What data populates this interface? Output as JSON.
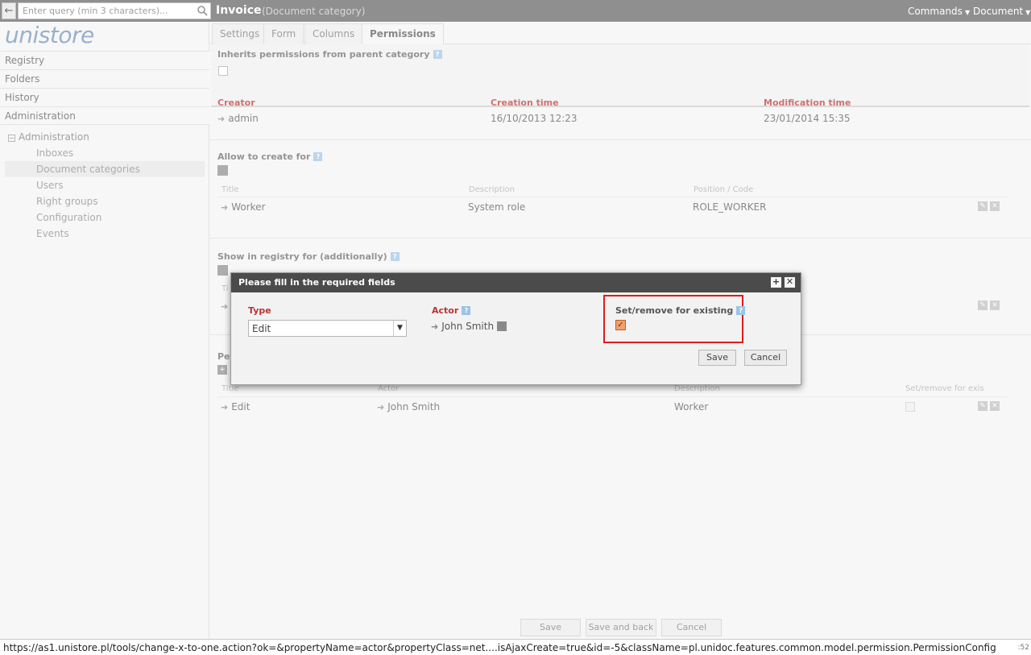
{
  "search": {
    "placeholder": "Enter query (min 3 characters)..."
  },
  "header": {
    "title": "Invoice",
    "subtitle": "(Document category)",
    "commands_label": "Commands",
    "document_label": "Document"
  },
  "sidebar": {
    "logo": "unistore",
    "nav": [
      "Registry",
      "Folders",
      "History",
      "Administration"
    ],
    "tree_root": "Administration",
    "tree_items": [
      "Inboxes",
      "Document categories",
      "Users",
      "Right groups",
      "Configuration",
      "Events"
    ]
  },
  "tabs": [
    "Settings",
    "Form",
    "Columns",
    "Permissions"
  ],
  "inherit": {
    "label": "Inherits permissions from parent category",
    "checked": false
  },
  "meta": {
    "creator_label": "Creator",
    "creator_value": "admin",
    "creation_label": "Creation time",
    "creation_value": "16/10/2013 12:23",
    "modification_label": "Modification time",
    "modification_value": "23/01/2014 15:35"
  },
  "allow_create": {
    "title": "Allow to create for",
    "columns": [
      "Title",
      "Description",
      "Position / Code"
    ],
    "row": {
      "title": "Worker",
      "description": "System role",
      "code": "ROLE_WORKER"
    }
  },
  "show_registry": {
    "title": "Show in registry for (additionally)",
    "col_fragment": "Ti"
  },
  "permissions": {
    "title_fragment": "Per",
    "columns": [
      "Title",
      "Actor",
      "Description",
      "Set/remove for exis"
    ],
    "row": {
      "title": "Edit",
      "actor": "John Smith",
      "description": "Worker"
    }
  },
  "footer_buttons": {
    "save": "Save",
    "save_back": "Save and back",
    "cancel": "Cancel"
  },
  "dialog": {
    "title": "Please fill in the required fields",
    "type_label": "Type",
    "type_value": "Edit",
    "actor_label": "Actor",
    "actor_value": "John Smith",
    "setremove_label": "Set/remove for existing",
    "setremove_checked": true,
    "save_label": "Save",
    "cancel_label": "Cancel"
  },
  "status": {
    "url": "https://as1.unistore.pl/tools/change-x-to-one.action?ok=&propertyName=actor&propertyClass=net....isAjaxCreate=true&id=-5&className=pl.unidoc.features.common.model.permission.PermissionConfig",
    "right": ":52"
  },
  "colors": {
    "topbar": "#5f5f5f",
    "required_label": "#bb3333",
    "highlight": "#e01b1b"
  }
}
